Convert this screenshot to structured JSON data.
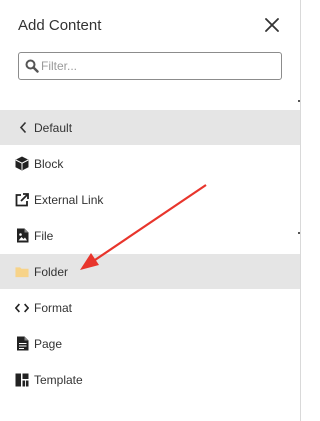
{
  "header": {
    "title": "Add Content"
  },
  "search": {
    "placeholder": "Filter..."
  },
  "nav": {
    "back_label": "Default"
  },
  "items": [
    {
      "label": "Block",
      "icon": "cube-icon"
    },
    {
      "label": "External Link",
      "icon": "external-link-icon"
    },
    {
      "label": "File",
      "icon": "file-image-icon"
    },
    {
      "label": "Folder",
      "icon": "folder-icon",
      "highlighted": true
    },
    {
      "label": "Format",
      "icon": "code-icon"
    },
    {
      "label": "Page",
      "icon": "document-icon"
    },
    {
      "label": "Template",
      "icon": "template-grid-icon"
    }
  ],
  "colors": {
    "highlight_bg": "#e5e5e5",
    "folder_icon": "#f7d389",
    "annotation_arrow": "#e8352c"
  }
}
